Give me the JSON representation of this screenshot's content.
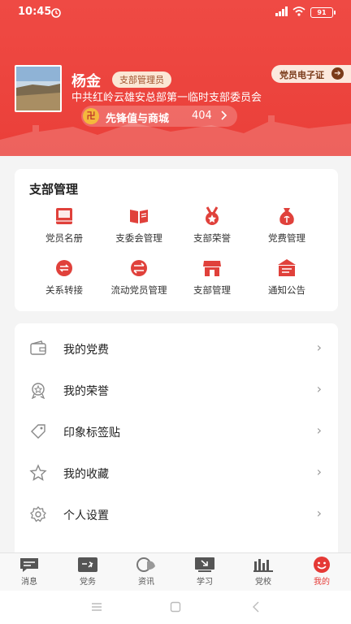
{
  "status": {
    "time": "10:45",
    "battery": "91"
  },
  "profile": {
    "name": "杨金",
    "role": "支部管理员",
    "org": "中共红岭云雄安总部第一临时支部委员会",
    "coin_icon": "卍",
    "points_label": "先锋值与商城",
    "points_value": "404",
    "card_label": "党员电子证"
  },
  "branch": {
    "title": "支部管理",
    "items": [
      {
        "label": "党员名册",
        "icon": "book-icon"
      },
      {
        "label": "支委会管理",
        "icon": "open-book-icon"
      },
      {
        "label": "支部荣誉",
        "icon": "medal-icon"
      },
      {
        "label": "党费管理",
        "icon": "money-bag-icon"
      },
      {
        "label": "关系转接",
        "icon": "transfer-icon"
      },
      {
        "label": "流动党员管理",
        "icon": "swap-icon"
      },
      {
        "label": "支部管理",
        "icon": "store-icon"
      },
      {
        "label": "通知公告",
        "icon": "notice-icon"
      }
    ]
  },
  "menu": [
    {
      "label": "我的党费",
      "icon": "wallet-icon"
    },
    {
      "label": "我的荣誉",
      "icon": "award-icon"
    },
    {
      "label": "印象标签贴",
      "icon": "tag-icon"
    },
    {
      "label": "我的收藏",
      "icon": "star-icon"
    },
    {
      "label": "个人设置",
      "icon": "gear-icon"
    }
  ],
  "tabs": [
    {
      "label": "消息",
      "icon": "chat-icon"
    },
    {
      "label": "党务",
      "icon": "party-icon"
    },
    {
      "label": "资讯",
      "icon": "news-icon"
    },
    {
      "label": "学习",
      "icon": "study-icon"
    },
    {
      "label": "党校",
      "icon": "school-icon"
    },
    {
      "label": "我的",
      "icon": "profile-icon"
    }
  ],
  "colors": {
    "brand_red": "#ea3f39",
    "icon_red": "#e0413b"
  }
}
